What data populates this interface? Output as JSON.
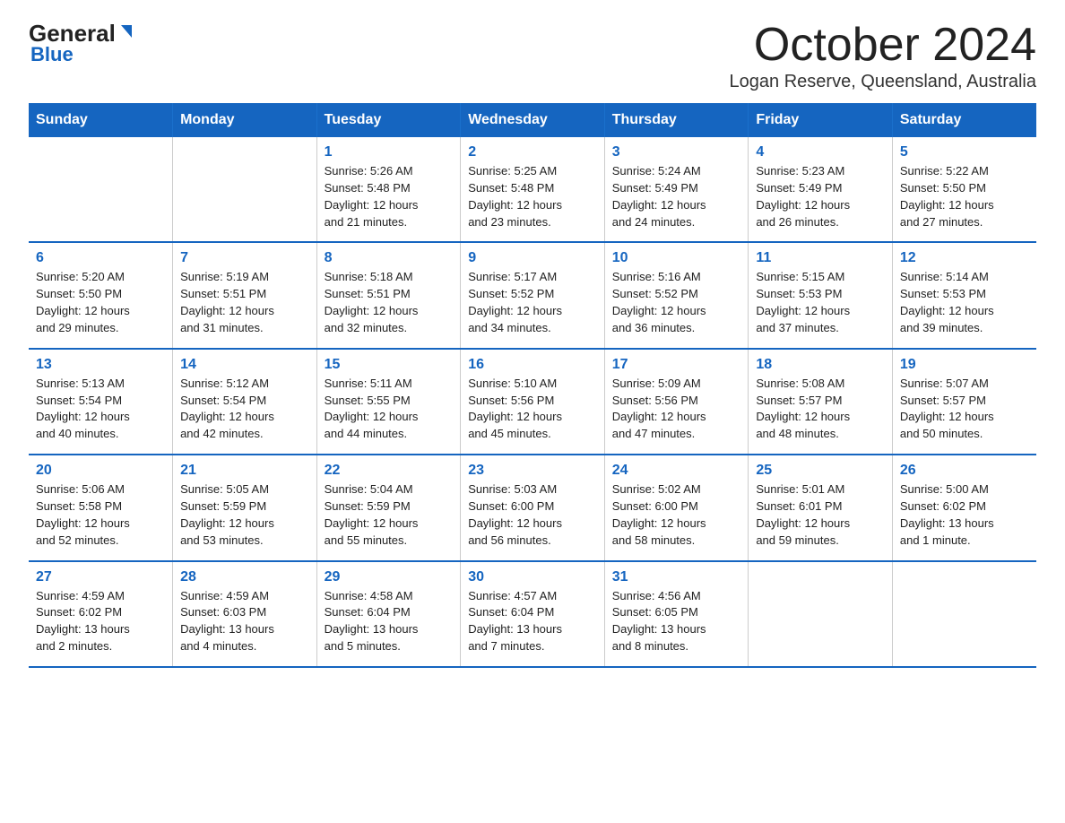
{
  "logo": {
    "general": "General",
    "blue": "Blue"
  },
  "title": "October 2024",
  "subtitle": "Logan Reserve, Queensland, Australia",
  "days_of_week": [
    "Sunday",
    "Monday",
    "Tuesday",
    "Wednesday",
    "Thursday",
    "Friday",
    "Saturday"
  ],
  "weeks": [
    [
      {
        "num": "",
        "info": ""
      },
      {
        "num": "",
        "info": ""
      },
      {
        "num": "1",
        "info": "Sunrise: 5:26 AM\nSunset: 5:48 PM\nDaylight: 12 hours\nand 21 minutes."
      },
      {
        "num": "2",
        "info": "Sunrise: 5:25 AM\nSunset: 5:48 PM\nDaylight: 12 hours\nand 23 minutes."
      },
      {
        "num": "3",
        "info": "Sunrise: 5:24 AM\nSunset: 5:49 PM\nDaylight: 12 hours\nand 24 minutes."
      },
      {
        "num": "4",
        "info": "Sunrise: 5:23 AM\nSunset: 5:49 PM\nDaylight: 12 hours\nand 26 minutes."
      },
      {
        "num": "5",
        "info": "Sunrise: 5:22 AM\nSunset: 5:50 PM\nDaylight: 12 hours\nand 27 minutes."
      }
    ],
    [
      {
        "num": "6",
        "info": "Sunrise: 5:20 AM\nSunset: 5:50 PM\nDaylight: 12 hours\nand 29 minutes."
      },
      {
        "num": "7",
        "info": "Sunrise: 5:19 AM\nSunset: 5:51 PM\nDaylight: 12 hours\nand 31 minutes."
      },
      {
        "num": "8",
        "info": "Sunrise: 5:18 AM\nSunset: 5:51 PM\nDaylight: 12 hours\nand 32 minutes."
      },
      {
        "num": "9",
        "info": "Sunrise: 5:17 AM\nSunset: 5:52 PM\nDaylight: 12 hours\nand 34 minutes."
      },
      {
        "num": "10",
        "info": "Sunrise: 5:16 AM\nSunset: 5:52 PM\nDaylight: 12 hours\nand 36 minutes."
      },
      {
        "num": "11",
        "info": "Sunrise: 5:15 AM\nSunset: 5:53 PM\nDaylight: 12 hours\nand 37 minutes."
      },
      {
        "num": "12",
        "info": "Sunrise: 5:14 AM\nSunset: 5:53 PM\nDaylight: 12 hours\nand 39 minutes."
      }
    ],
    [
      {
        "num": "13",
        "info": "Sunrise: 5:13 AM\nSunset: 5:54 PM\nDaylight: 12 hours\nand 40 minutes."
      },
      {
        "num": "14",
        "info": "Sunrise: 5:12 AM\nSunset: 5:54 PM\nDaylight: 12 hours\nand 42 minutes."
      },
      {
        "num": "15",
        "info": "Sunrise: 5:11 AM\nSunset: 5:55 PM\nDaylight: 12 hours\nand 44 minutes."
      },
      {
        "num": "16",
        "info": "Sunrise: 5:10 AM\nSunset: 5:56 PM\nDaylight: 12 hours\nand 45 minutes."
      },
      {
        "num": "17",
        "info": "Sunrise: 5:09 AM\nSunset: 5:56 PM\nDaylight: 12 hours\nand 47 minutes."
      },
      {
        "num": "18",
        "info": "Sunrise: 5:08 AM\nSunset: 5:57 PM\nDaylight: 12 hours\nand 48 minutes."
      },
      {
        "num": "19",
        "info": "Sunrise: 5:07 AM\nSunset: 5:57 PM\nDaylight: 12 hours\nand 50 minutes."
      }
    ],
    [
      {
        "num": "20",
        "info": "Sunrise: 5:06 AM\nSunset: 5:58 PM\nDaylight: 12 hours\nand 52 minutes."
      },
      {
        "num": "21",
        "info": "Sunrise: 5:05 AM\nSunset: 5:59 PM\nDaylight: 12 hours\nand 53 minutes."
      },
      {
        "num": "22",
        "info": "Sunrise: 5:04 AM\nSunset: 5:59 PM\nDaylight: 12 hours\nand 55 minutes."
      },
      {
        "num": "23",
        "info": "Sunrise: 5:03 AM\nSunset: 6:00 PM\nDaylight: 12 hours\nand 56 minutes."
      },
      {
        "num": "24",
        "info": "Sunrise: 5:02 AM\nSunset: 6:00 PM\nDaylight: 12 hours\nand 58 minutes."
      },
      {
        "num": "25",
        "info": "Sunrise: 5:01 AM\nSunset: 6:01 PM\nDaylight: 12 hours\nand 59 minutes."
      },
      {
        "num": "26",
        "info": "Sunrise: 5:00 AM\nSunset: 6:02 PM\nDaylight: 13 hours\nand 1 minute."
      }
    ],
    [
      {
        "num": "27",
        "info": "Sunrise: 4:59 AM\nSunset: 6:02 PM\nDaylight: 13 hours\nand 2 minutes."
      },
      {
        "num": "28",
        "info": "Sunrise: 4:59 AM\nSunset: 6:03 PM\nDaylight: 13 hours\nand 4 minutes."
      },
      {
        "num": "29",
        "info": "Sunrise: 4:58 AM\nSunset: 6:04 PM\nDaylight: 13 hours\nand 5 minutes."
      },
      {
        "num": "30",
        "info": "Sunrise: 4:57 AM\nSunset: 6:04 PM\nDaylight: 13 hours\nand 7 minutes."
      },
      {
        "num": "31",
        "info": "Sunrise: 4:56 AM\nSunset: 6:05 PM\nDaylight: 13 hours\nand 8 minutes."
      },
      {
        "num": "",
        "info": ""
      },
      {
        "num": "",
        "info": ""
      }
    ]
  ]
}
